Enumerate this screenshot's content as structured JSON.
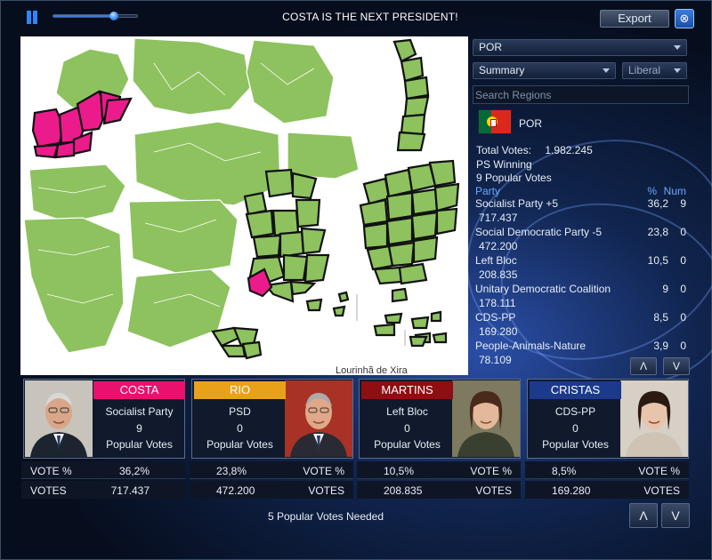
{
  "header": {
    "title": "COSTA IS THE NEXT PRESIDENT!",
    "export_label": "Export",
    "close_label": "⊗",
    "timeline_progress": 0.72
  },
  "map": {
    "hover_label": "Lourinhã de Xira",
    "colors": {
      "won": "#8dc25f",
      "highlight": "#ec1b8c",
      "outline": "#ffffff",
      "region_border": "#111111"
    }
  },
  "side": {
    "country_select": "POR",
    "view_select": "Summary",
    "ideology_select": "Liberal",
    "search_placeholder": "Search Regions",
    "region_name": "POR",
    "total_votes_label": "Total Votes:",
    "total_votes_value": "1.982.245",
    "winning_text": "PS Winning",
    "popular_votes_text": "9 Popular Votes",
    "col_party": "Party",
    "col_pct": "%",
    "col_num": "Num",
    "parties": [
      {
        "name": "Socialist Party +5",
        "votes": "717.437",
        "pct": "36,2",
        "num": "9"
      },
      {
        "name": "Social Democratic Party -5",
        "votes": "472.200",
        "pct": "23,8",
        "num": "0"
      },
      {
        "name": "Left Bloc",
        "votes": "208.835",
        "pct": "10,5",
        "num": "0"
      },
      {
        "name": "Unitary Democratic Coalition",
        "votes": "178.111",
        "pct": "9",
        "num": "0"
      },
      {
        "name": "CDS-PP",
        "votes": "169.280",
        "pct": "8,5",
        "num": "0"
      },
      {
        "name": "People-Animals-Nature",
        "votes": "78.109",
        "pct": "3,9",
        "num": "0"
      }
    ],
    "up_label": "Λ",
    "down_label": "V"
  },
  "candidates": [
    {
      "name": "COSTA",
      "party": "Socialist Party",
      "votes": "9",
      "votes_label": "Popular Votes",
      "color": "#e8116e",
      "vote_pct_label": "VOTE %",
      "vote_pct": "36,2%",
      "votes_row_label": "VOTES",
      "votes_total": "717.437"
    },
    {
      "name": "RIO",
      "party": "PSD",
      "votes": "0",
      "votes_label": "Popular Votes",
      "color": "#e8a21a",
      "vote_pct_label": "VOTE %",
      "vote_pct": "23,8%",
      "votes_row_label": "VOTES",
      "votes_total": "472.200"
    },
    {
      "name": "MARTINS",
      "party": "Left Bloc",
      "votes": "0",
      "votes_label": "Popular Votes",
      "color": "#8e0e12",
      "vote_pct_label": "VOTE %",
      "vote_pct": "10,5%",
      "votes_row_label": "VOTES",
      "votes_total": "208.835"
    },
    {
      "name": "CRISTAS",
      "party": "CDS-PP",
      "votes": "0",
      "votes_label": "Popular Votes",
      "color": "#1c3a8c",
      "vote_pct_label": "VOTE %",
      "vote_pct": "8,5%",
      "votes_row_label": "VOTES",
      "votes_total": "169.280"
    }
  ],
  "footer": {
    "needed_text": "5 Popular Votes Needed",
    "up_label": "Λ",
    "down_label": "V"
  }
}
